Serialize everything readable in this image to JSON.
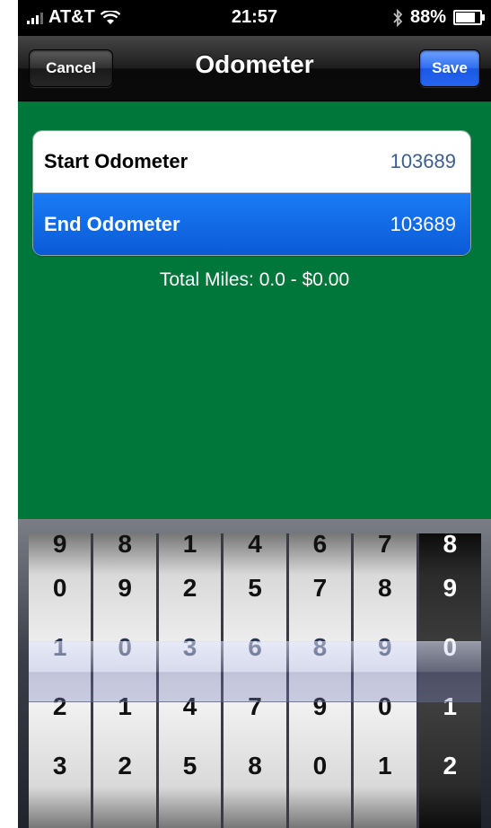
{
  "status_bar": {
    "carrier": "AT&T",
    "time": "21:57",
    "battery": "88%",
    "battery_level": 0.88,
    "icons": [
      "signal-icon",
      "wifi-icon",
      "bluetooth-icon",
      "battery-icon"
    ]
  },
  "nav": {
    "title": "Odometer",
    "cancel_label": "Cancel",
    "save_label": "Save"
  },
  "table": {
    "rows": [
      {
        "label": "Start Odometer",
        "value": "103689"
      },
      {
        "label": "End Odometer",
        "value": "103689"
      }
    ]
  },
  "total_text": "Total Miles: 0.0 - $0.00",
  "picker": {
    "wheels": [
      {
        "digits": [
          "9",
          "0",
          "1",
          "2",
          "3"
        ]
      },
      {
        "digits": [
          "8",
          "9",
          "0",
          "1",
          "2"
        ]
      },
      {
        "digits": [
          "1",
          "2",
          "3",
          "4",
          "5"
        ]
      },
      {
        "digits": [
          "4",
          "5",
          "6",
          "7",
          "8"
        ]
      },
      {
        "digits": [
          "6",
          "7",
          "8",
          "9",
          "0"
        ]
      },
      {
        "digits": [
          "7",
          "8",
          "9",
          "0",
          "1"
        ]
      },
      {
        "digits": [
          "8",
          "9",
          "0",
          "1",
          "2"
        ]
      }
    ]
  },
  "colors": {
    "background": "#00773a",
    "selected_row": "#0b5ad7",
    "save_button": "#2f6df0"
  }
}
